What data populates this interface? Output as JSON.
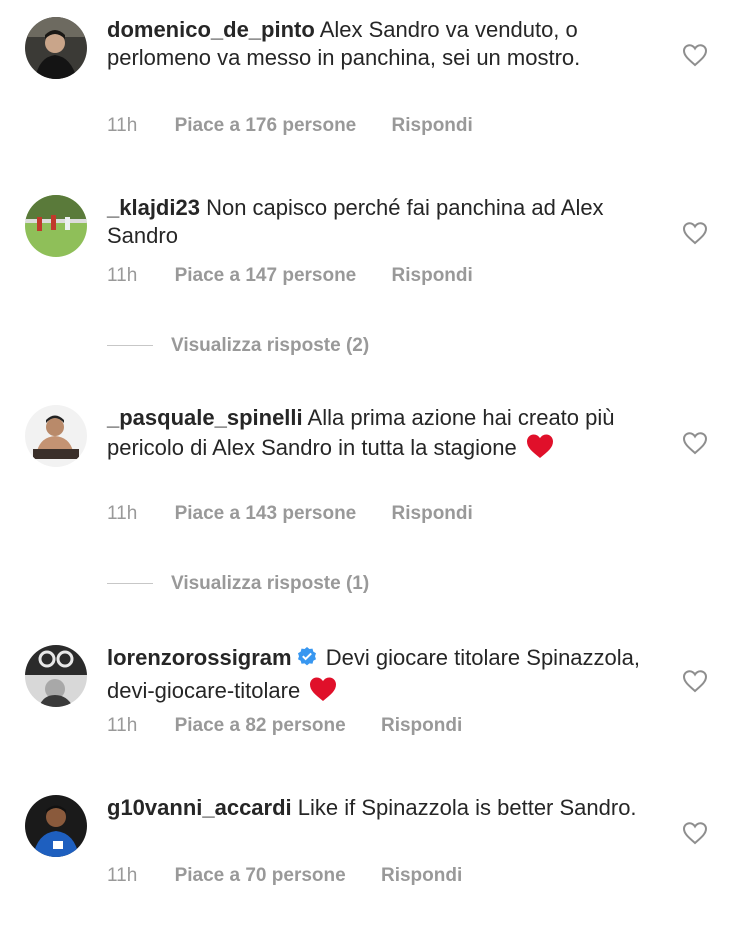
{
  "comments": [
    {
      "username": "domenico_de_pinto",
      "text": "Alex Sandro va venduto, o perlomeno va messo in panchina, sei un mostro.",
      "time": "11h",
      "likes": "Piace a 176 persone",
      "reply": "Rispondi"
    },
    {
      "username": "_klajdi23",
      "text": "Non capisco perché fai panchina ad Alex Sandro",
      "time": "11h",
      "likes": "Piace a 147 persone",
      "reply": "Rispondi",
      "view_replies": "Visualizza risposte (2)"
    },
    {
      "username": "_pasquale_spinelli",
      "text": "Alla prima azione hai creato più pericolo di Alex Sandro in tutta la stagione",
      "emoji": "red-heart",
      "time": "11h",
      "likes": "Piace a 143 persone",
      "reply": "Rispondi",
      "view_replies": "Visualizza risposte (1)"
    },
    {
      "username": "lorenzorossigram",
      "verified": true,
      "text": "Devi giocare titolare Spinazzola, devi-giocare-titolare",
      "emoji": "red-heart",
      "time": "11h",
      "likes": "Piace a 82 persone",
      "reply": "Rispondi"
    },
    {
      "username": "g10vanni_accardi",
      "text": "Like if Spinazzola is better Sandro.",
      "time": "11h",
      "likes": "Piace a 70 persone",
      "reply": "Rispondi"
    }
  ],
  "icons": {
    "like": "heart-outline-icon",
    "verified": "verified-badge-icon",
    "emoji": "red-heart-emoji"
  },
  "colors": {
    "text": "#262626",
    "meta": "#999999",
    "verified": "#3897f0",
    "emoji_heart": "#e0102a"
  }
}
